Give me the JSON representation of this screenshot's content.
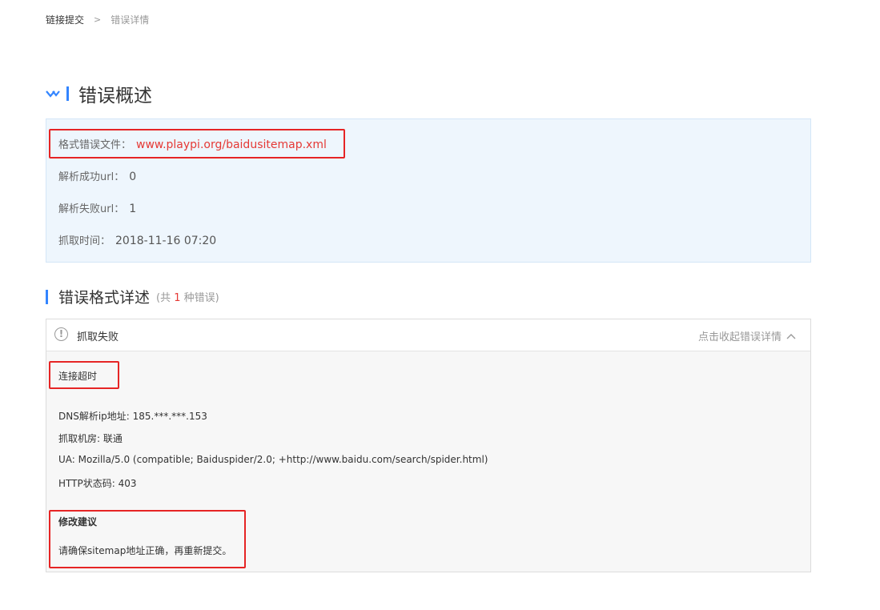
{
  "breadcrumb": {
    "parent": "链接提交",
    "separator": ">",
    "current": "错误详情"
  },
  "overview": {
    "title": "错误概述",
    "file_label": "格式错误文件：",
    "file_url": "www.playpi.org/baidusitemap.xml",
    "success_label": "解析成功url：",
    "success_value": "0",
    "fail_label": "解析失败url：",
    "fail_value": "1",
    "time_label": "抓取时间：",
    "time_value": "2018-11-16 07:20"
  },
  "details": {
    "title": "错误格式详述",
    "count_prefix": "(共",
    "count_value": "1",
    "count_suffix": "种错误)",
    "error": {
      "name": "抓取失败",
      "toggle_label": "点击收起错误详情",
      "reason": "连接超时",
      "dns_line": "DNS解析ip地址: 185.***.***.153",
      "room_line": "抓取机房: 联通",
      "ua_line": "UA: Mozilla/5.0 (compatible; Baiduspider/2.0; +http://www.baidu.com/search/spider.html)",
      "status_line": "HTTP状态码: 403",
      "suggestion_title": "修改建议",
      "suggestion_text": "请确保sitemap地址正确，再重新提交。"
    }
  },
  "colors": {
    "accent_blue": "#3385ff",
    "error_red": "#e53935",
    "highlight_red": "#e62525",
    "summary_bg": "#eef6fd"
  }
}
